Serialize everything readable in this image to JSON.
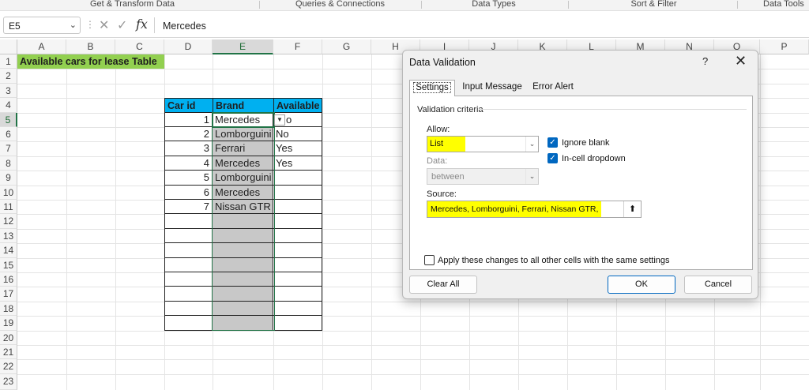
{
  "ribbon": {
    "groups": [
      "Get & Transform Data",
      "Queries & Connections",
      "Data Types",
      "Sort & Filter",
      "Data Tools"
    ]
  },
  "formula_bar": {
    "name_box": "E5",
    "formula": "Mercedes",
    "fx_label": "fx"
  },
  "grid": {
    "columns": [
      "A",
      "B",
      "C",
      "D",
      "E",
      "F",
      "G",
      "H",
      "I",
      "J",
      "K",
      "L",
      "M",
      "N",
      "O",
      "P"
    ],
    "rows": [
      "1",
      "2",
      "3",
      "4",
      "5",
      "6",
      "7",
      "8",
      "9",
      "10",
      "11",
      "12",
      "13",
      "14",
      "15",
      "16",
      "17",
      "18",
      "19",
      "20",
      "21",
      "22",
      "23"
    ],
    "selected_column": "E",
    "selected_row": "5",
    "title": "Available cars for lease Table",
    "table_headers": [
      "Car id",
      "Brand",
      "Available"
    ],
    "table_rows": [
      {
        "id": "1",
        "brand": "Mercedes",
        "available": "o"
      },
      {
        "id": "2",
        "brand": "Lomborguini",
        "available": "No"
      },
      {
        "id": "3",
        "brand": "Ferrari",
        "available": "Yes"
      },
      {
        "id": "4",
        "brand": "Mercedes",
        "available": "Yes"
      },
      {
        "id": "5",
        "brand": "Lomborguini",
        "available": ""
      },
      {
        "id": "6",
        "brand": "Mercedes",
        "available": ""
      },
      {
        "id": "7",
        "brand": "Nissan GTR",
        "available": ""
      }
    ]
  },
  "dialog": {
    "title": "Data Validation",
    "help": "?",
    "close": "✕",
    "tabs": [
      "Settings",
      "Input Message",
      "Error Alert"
    ],
    "group_label": "Validation criteria",
    "allow_label": "Allow:",
    "allow_value": "List",
    "ignore_blank": "Ignore blank",
    "in_cell_dropdown": "In-cell dropdown",
    "data_label": "Data:",
    "data_value": "between",
    "source_label": "Source:",
    "source_value": "Mercedes, Lomborguini, Ferrari, Nissan GTR,",
    "apply_all": "Apply these changes to all other cells with the same settings",
    "clear_all": "Clear All",
    "ok": "OK",
    "cancel": "Cancel"
  },
  "colors": {
    "title_fill": "#92d050",
    "header_fill": "#00b0f0",
    "selected_fill": "#c8c8c8",
    "highlight": "#ffff00",
    "accent": "#217346"
  }
}
